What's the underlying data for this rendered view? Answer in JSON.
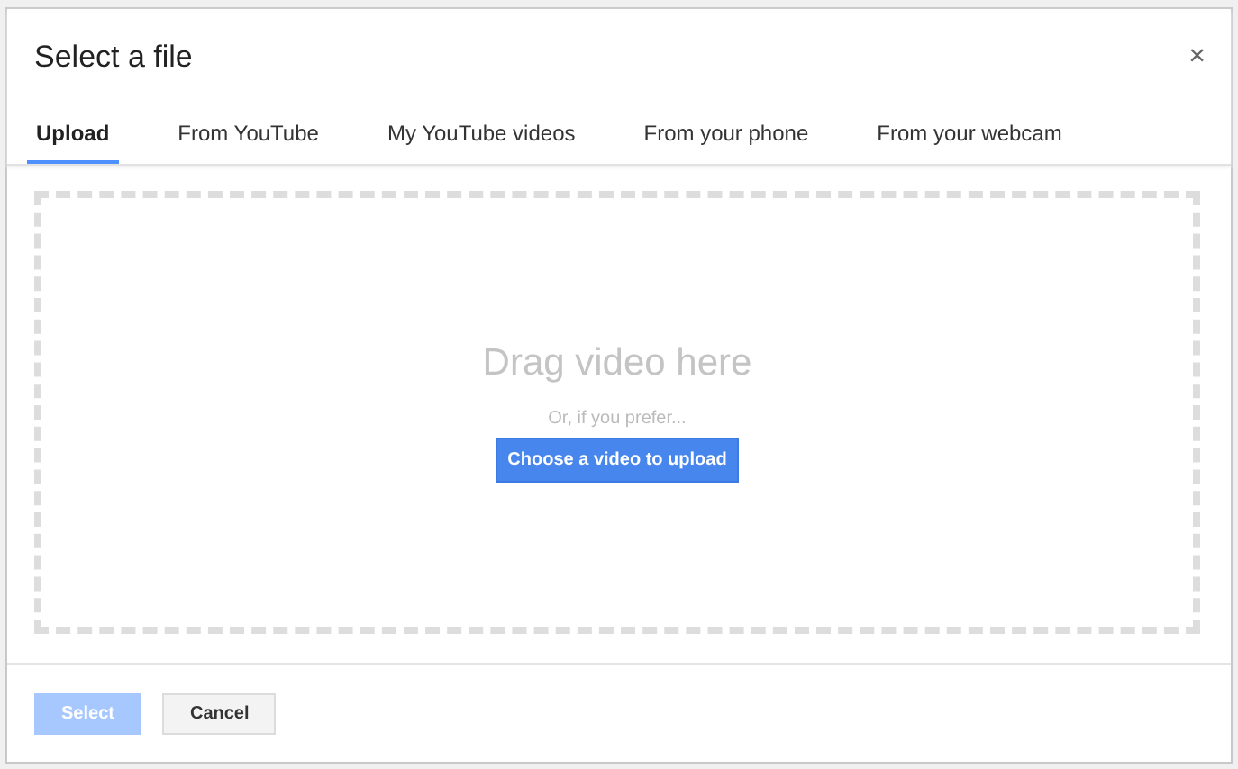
{
  "dialog": {
    "title": "Select a file",
    "close": "×"
  },
  "tabs": [
    {
      "label": "Upload",
      "selected": true
    },
    {
      "label": "From YouTube",
      "selected": false
    },
    {
      "label": "My YouTube videos",
      "selected": false
    },
    {
      "label": "From your phone",
      "selected": false
    },
    {
      "label": "From your webcam",
      "selected": false
    }
  ],
  "drop_zone": {
    "heading": "Drag video here",
    "hint": "Or, if you prefer...",
    "button": "Choose a video to upload"
  },
  "buttons": [
    {
      "label": "Select",
      "kind": "primary",
      "disabled": true
    },
    {
      "label": "Cancel",
      "kind": "secondary",
      "disabled": false
    }
  ]
}
